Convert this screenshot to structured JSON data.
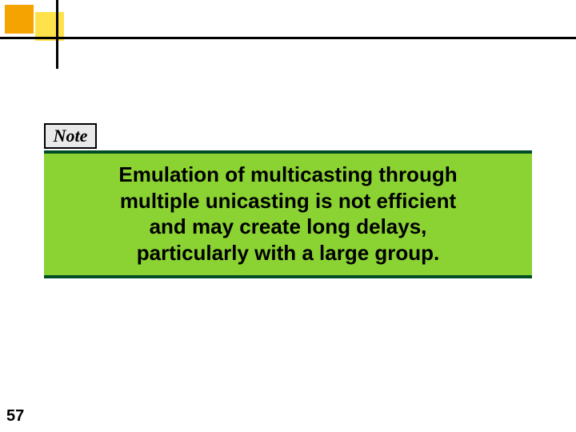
{
  "header": {
    "decor": {
      "orange": "#f5a300",
      "yellow": "#ffe14a",
      "line": "#000000"
    }
  },
  "note": {
    "label": "Note"
  },
  "callout": {
    "line1": "Emulation of multicasting through",
    "line2": "multiple unicasting is not efficient",
    "line3": "and may create long delays,",
    "line4": "particularly with a large group.",
    "bg": "#8bd332",
    "bar": "#004d26"
  },
  "footer": {
    "page_number": "57"
  }
}
